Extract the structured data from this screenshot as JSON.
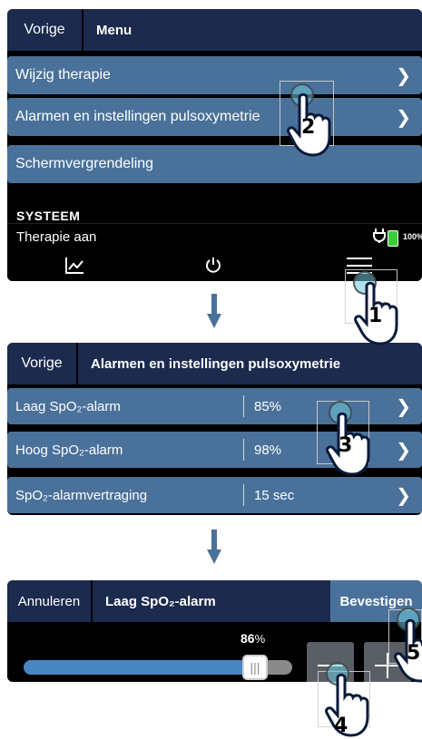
{
  "screen1": {
    "back_label": "Vorige",
    "title": "Menu",
    "items": [
      {
        "label": "Wijzig therapie"
      },
      {
        "label": "Alarmen en instellingen pulsoxymetrie"
      },
      {
        "label": "Schermvergrendeling"
      }
    ],
    "section_label": "SYSTEEM",
    "status_text": "Therapie aan",
    "battery_pct": "100%",
    "nav": [
      {
        "icon": "trend-chart-icon"
      },
      {
        "icon": "power-icon"
      },
      {
        "icon": "menu-icon"
      }
    ]
  },
  "screen2": {
    "back_label": "Vorige",
    "title": "Alarmen en instellingen pulsoxymetrie",
    "rows": [
      {
        "label": "Laag SpO₂-alarm",
        "value": "85%"
      },
      {
        "label": "Hoog SpO₂-alarm",
        "value": "98%"
      },
      {
        "label": "SpO₂-alarmvertraging",
        "value": "15 sec"
      }
    ]
  },
  "screen3": {
    "cancel_label": "Annuleren",
    "title": "Laag SpO₂-alarm",
    "confirm_label": "Bevestigen",
    "slider": {
      "value": "86",
      "unit": "%",
      "min": "2",
      "max": "98",
      "level": 86
    }
  },
  "steps": [
    "1",
    "2",
    "3",
    "4",
    "5"
  ],
  "colors": {
    "header": "#1b2a4d",
    "row": "#4a719a",
    "slider_fill": "#4a86c0",
    "arrow": "#4a719a"
  }
}
